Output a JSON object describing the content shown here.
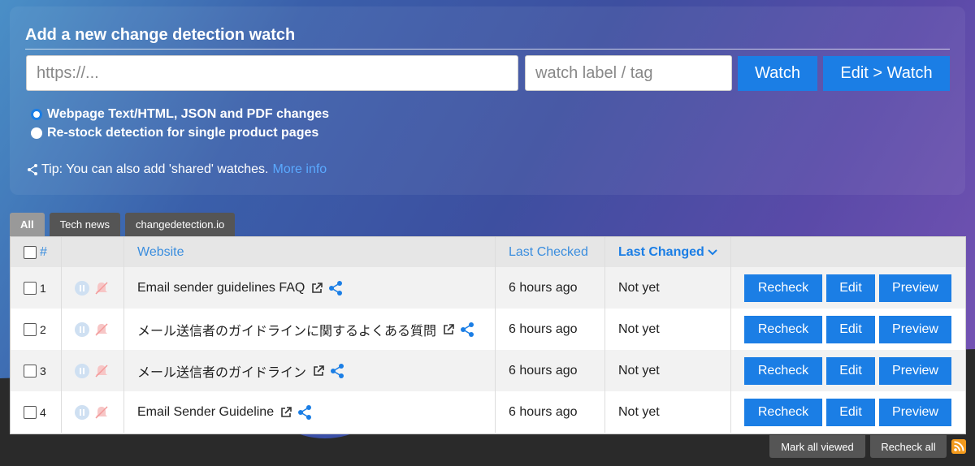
{
  "panel": {
    "title": "Add a new change detection watch",
    "url_placeholder": "https://...",
    "tag_placeholder": "watch label / tag",
    "watch_label": "Watch",
    "edit_watch_label": "Edit > Watch",
    "radio_options": [
      {
        "label": "Webpage Text/HTML, JSON and PDF changes",
        "checked": true
      },
      {
        "label": "Re-stock detection for single product pages",
        "checked": false
      }
    ],
    "tip_text": "Tip: You can also add 'shared' watches.",
    "tip_link": "More info"
  },
  "tabs": [
    {
      "label": "All",
      "active": true
    },
    {
      "label": "Tech news",
      "active": false
    },
    {
      "label": "changedetection.io",
      "active": false
    }
  ],
  "table": {
    "headers": {
      "num": "#",
      "website": "Website",
      "last_checked": "Last Checked",
      "last_changed": "Last Changed"
    },
    "rows": [
      {
        "num": "1",
        "website": "Email sender guidelines FAQ",
        "last_checked": "6 hours ago",
        "last_changed": "Not yet"
      },
      {
        "num": "2",
        "website": "メール送信者のガイドラインに関するよくある質問",
        "last_checked": "6 hours ago",
        "last_changed": "Not yet"
      },
      {
        "num": "3",
        "website": "メール送信者のガイドライン",
        "last_checked": "6 hours ago",
        "last_changed": "Not yet"
      },
      {
        "num": "4",
        "website": "Email Sender Guideline",
        "last_checked": "6 hours ago",
        "last_changed": "Not yet"
      }
    ],
    "actions": {
      "recheck": "Recheck",
      "edit": "Edit",
      "preview": "Preview"
    }
  },
  "footer": {
    "mark_all_viewed": "Mark all viewed",
    "recheck_all": "Recheck all"
  },
  "colors": {
    "accent": "#1b7ee5",
    "link": "#5aa9ff",
    "rss": "#f39a1c"
  }
}
